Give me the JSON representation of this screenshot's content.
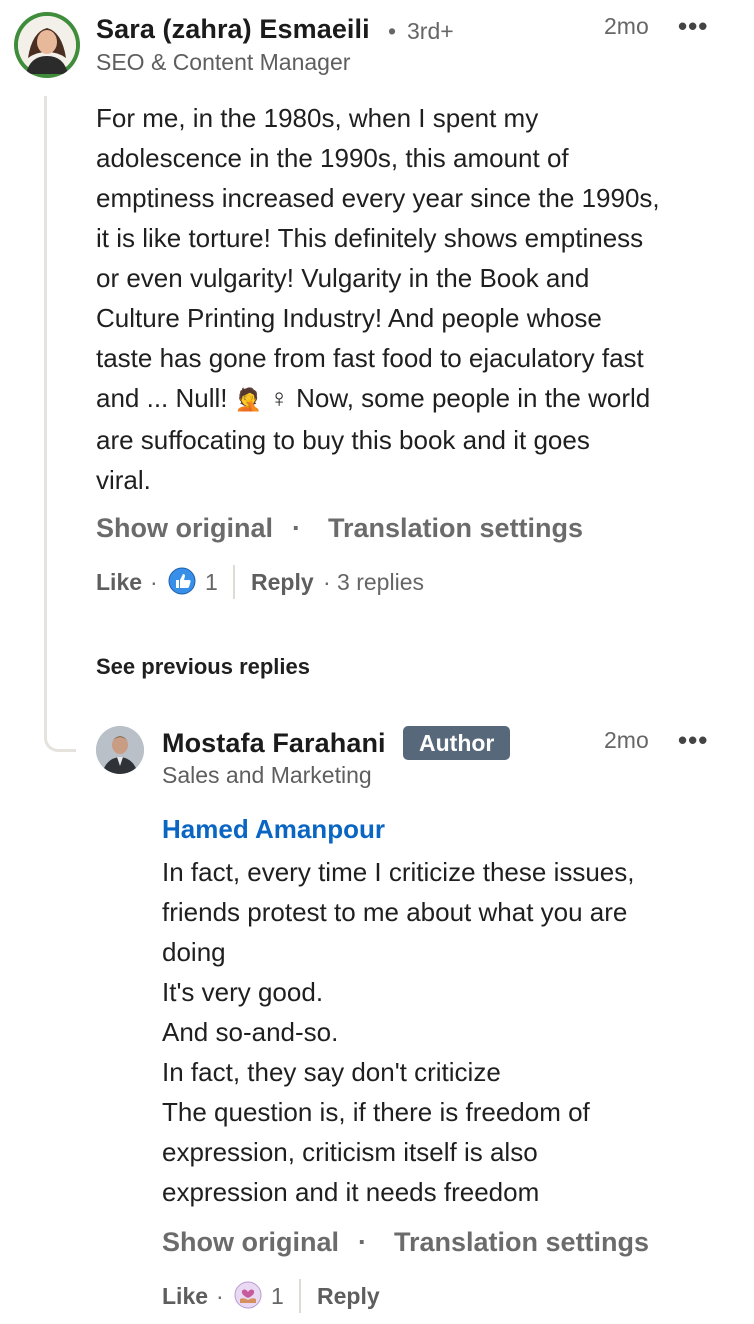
{
  "comment1": {
    "author": "Sara (zahra) Esmaeili",
    "degree_separator": "•",
    "degree": "3rd+",
    "headline": "SEO & Content Manager",
    "time": "2mo",
    "more": "•••",
    "body_lines": [
      "For me, in the 1980s, when I spent my",
      "adolescence in the 1990s, this amount of",
      "emptiness increased every year since the 1990s,",
      "it is like torture! This definitely shows emptiness",
      "or even vulgarity! Vulgarity in the Book and",
      "Culture Printing Industry! And people whose",
      "taste has gone from fast food to ejaculatory fast"
    ],
    "body_line8_start": "and ... Null!",
    "emoji_person": "🤦",
    "emoji_female": "♀",
    "body_line8_end": "Now, some people in the world",
    "body_lines_after": [
      "are suffocating to buy this book and it goes",
      "viral."
    ],
    "show_original": "Show original",
    "translation_dot": "·",
    "translation_settings": "Translation settings",
    "like_label": "Like",
    "dot": "·",
    "reaction_icon": "like-thumb-icon",
    "reaction_count": "1",
    "reply_label": "Reply",
    "replies_text": "· 3 replies"
  },
  "see_previous": "See previous replies",
  "reply1": {
    "author": "Mostafa Farahani",
    "badge": "Author",
    "headline": "Sales and Marketing",
    "time": "2mo",
    "more": "•••",
    "mention": "Hamed Amanpour",
    "body_lines": [
      "In fact, every time I criticize these issues,",
      "friends protest to me about what you are",
      "doing",
      "It's very good.",
      "And so-and-so.",
      "In fact, they say don't criticize",
      "The question is, if there is freedom of",
      "expression, criticism itself is also",
      "expression and it needs freedom"
    ],
    "show_original": "Show original",
    "translation_dot": "·",
    "translation_settings": "Translation settings",
    "like_label": "Like",
    "dot": "·",
    "reaction_icon": "support-heart-hand-icon",
    "reaction_count": "1",
    "reply_label": "Reply"
  },
  "colors": {
    "link_blue": "#0a66c2",
    "badge_bg": "#56687a",
    "thread_line": "#e6e3de",
    "avatar_ring": "#3f8c3b"
  }
}
